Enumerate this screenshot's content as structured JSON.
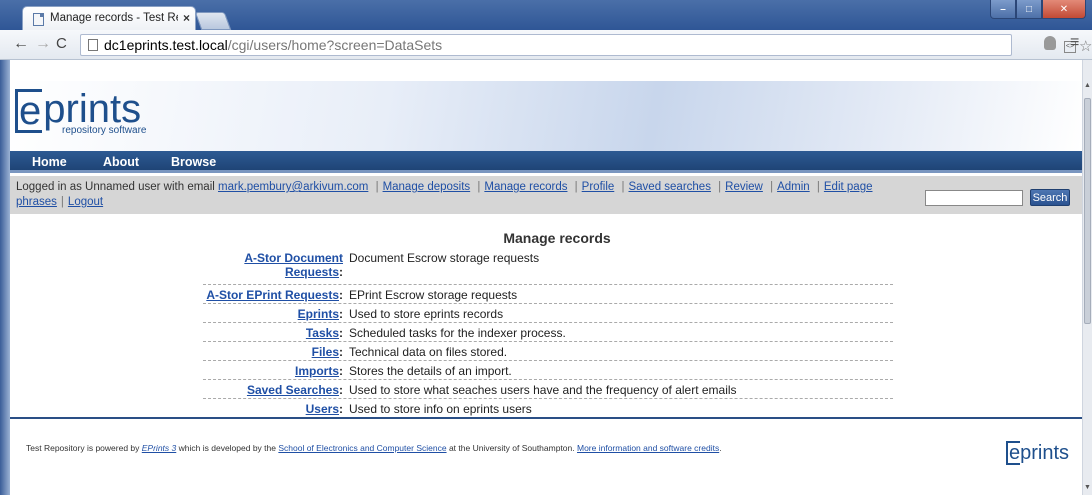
{
  "browser": {
    "tab_title": "Manage records - Test Rep",
    "tab_close": "×",
    "url_host": "dc1eprints.test.local",
    "url_path": "/cgi/users/home?screen=DataSets",
    "win_min": "–",
    "win_max": "□",
    "win_close": "✕"
  },
  "site": {
    "logo_e": "e",
    "logo_rest": "prints",
    "logo_tagline": "repository software",
    "menu": [
      "Home",
      "About",
      "Browse"
    ]
  },
  "login": {
    "prefix": "Logged in as Unnamed user with email",
    "email": "mark.pembury@arkivum.com",
    "links": [
      "Manage deposits",
      "Manage records",
      "Profile",
      "Saved searches",
      "Review",
      "Admin",
      "Edit page"
    ],
    "links_line2": [
      "phrases",
      "Logout"
    ],
    "search_button": "Search",
    "search_value": ""
  },
  "main": {
    "title": "Manage records",
    "records": [
      {
        "key": "A-Stor Document Requests",
        "value": "Document Escrow storage requests"
      },
      {
        "key": "A-Stor EPrint Requests",
        "value": "EPrint Escrow storage requests"
      },
      {
        "key": "Eprints",
        "value": "Used to store eprints records"
      },
      {
        "key": "Tasks",
        "value": "Scheduled tasks for the indexer process."
      },
      {
        "key": "Files",
        "value": "Technical data on files stored."
      },
      {
        "key": "Imports",
        "value": "Stores the details of an import."
      },
      {
        "key": "Saved Searches",
        "value": "Used to store what seaches users have and the frequency of alert emails"
      },
      {
        "key": "Users",
        "value": "Used to store info on eprints users"
      }
    ]
  },
  "footer": {
    "t1": "Test Repository is powered by",
    "link1": "EPrints 3",
    "t2": "which is developed by the",
    "link2": "School of Electronics and Computer Science",
    "t3": "at the University of Southampton.",
    "link3": "More information and software credits",
    "t4": ".",
    "logo_e": "e",
    "logo_rest": "prints"
  },
  "colors": {
    "link": "#1f4fa5",
    "menubar": "#1f4476",
    "loginbar": "#d6d6d6"
  }
}
